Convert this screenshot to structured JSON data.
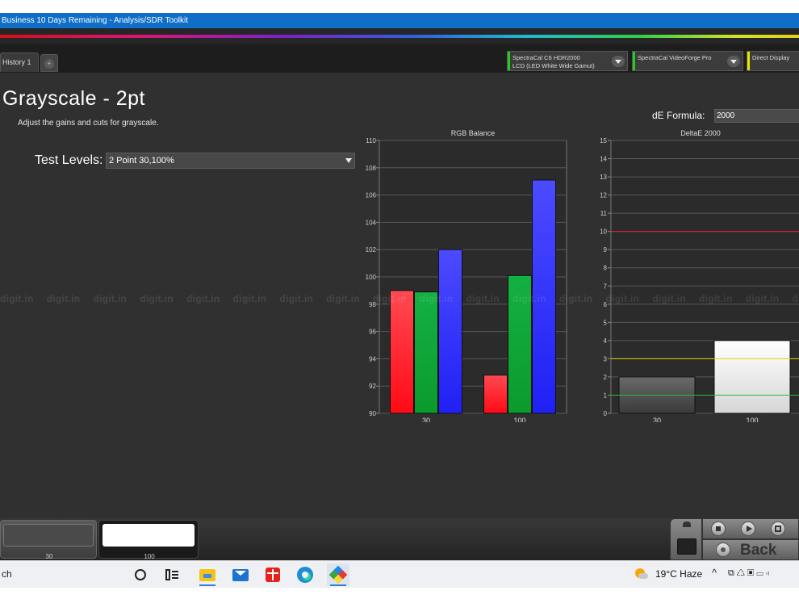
{
  "window": {
    "title": "Business 10 Days Remaining  - Analysis/SDR Toolkit"
  },
  "tabs": {
    "history_label": "History 1",
    "add_label": "+"
  },
  "devices": [
    {
      "line1": "SpectraCal C6 HDR2000",
      "line2": "LCD (LED White Wide Gamut)",
      "color": "#22cc22"
    },
    {
      "line1": "SpectraCal VideoForge Pro",
      "line2": "",
      "color": "#22cc22"
    },
    {
      "line1": "Direct Display",
      "line2": "",
      "color": "#e6e600"
    }
  ],
  "page": {
    "title": "Grayscale - 2pt",
    "subtitle": "Adjust the gains and cuts for grayscale.",
    "test_levels_label": "Test Levels:",
    "test_levels_value": "2 Point 30,100%",
    "de_formula_label": "dE Formula:",
    "de_formula_value": "2000",
    "watermark": "digit.in"
  },
  "chart_data": [
    {
      "type": "bar",
      "title": "RGB Balance",
      "categories": [
        "30",
        "100"
      ],
      "series": [
        {
          "name": "",
          "color": "#ff2a33",
          "values": [
            99.0,
            92.8
          ]
        },
        {
          "name": "",
          "color": "#0fa836",
          "values": [
            98.9,
            100.1
          ]
        },
        {
          "name": "",
          "color": "#3b3bff",
          "values": [
            102.0,
            107.1
          ]
        }
      ],
      "ylim": [
        90,
        110
      ],
      "yticks": [
        "90",
        "92",
        "94",
        "96",
        "98",
        "100",
        "102",
        "104",
        "106",
        "108",
        "110"
      ],
      "grid": true
    },
    {
      "type": "bar",
      "title": "DeltaE 2000",
      "categories": [
        "30",
        "100"
      ],
      "values": [
        2.0,
        4.0
      ],
      "ylim": [
        0,
        15
      ],
      "yticks": [
        "0",
        "1",
        "2",
        "3",
        "4",
        "5",
        "6",
        "7",
        "8",
        "9",
        "10",
        "11",
        "12",
        "13",
        "14",
        "15"
      ],
      "reference_lines": [
        {
          "value": 1,
          "color": "#25c22a"
        },
        {
          "value": 3,
          "color": "#d8d800"
        },
        {
          "value": 10,
          "color": "#e02020"
        }
      ],
      "grid": true
    }
  ],
  "bottom": {
    "swatches": [
      {
        "label": "30",
        "color": "#4a4a4a"
      },
      {
        "label": "100",
        "color": "#ffffff"
      }
    ],
    "back_label": "Back"
  },
  "taskbar": {
    "search_text": "ch",
    "weather": "19°C  Haze"
  }
}
